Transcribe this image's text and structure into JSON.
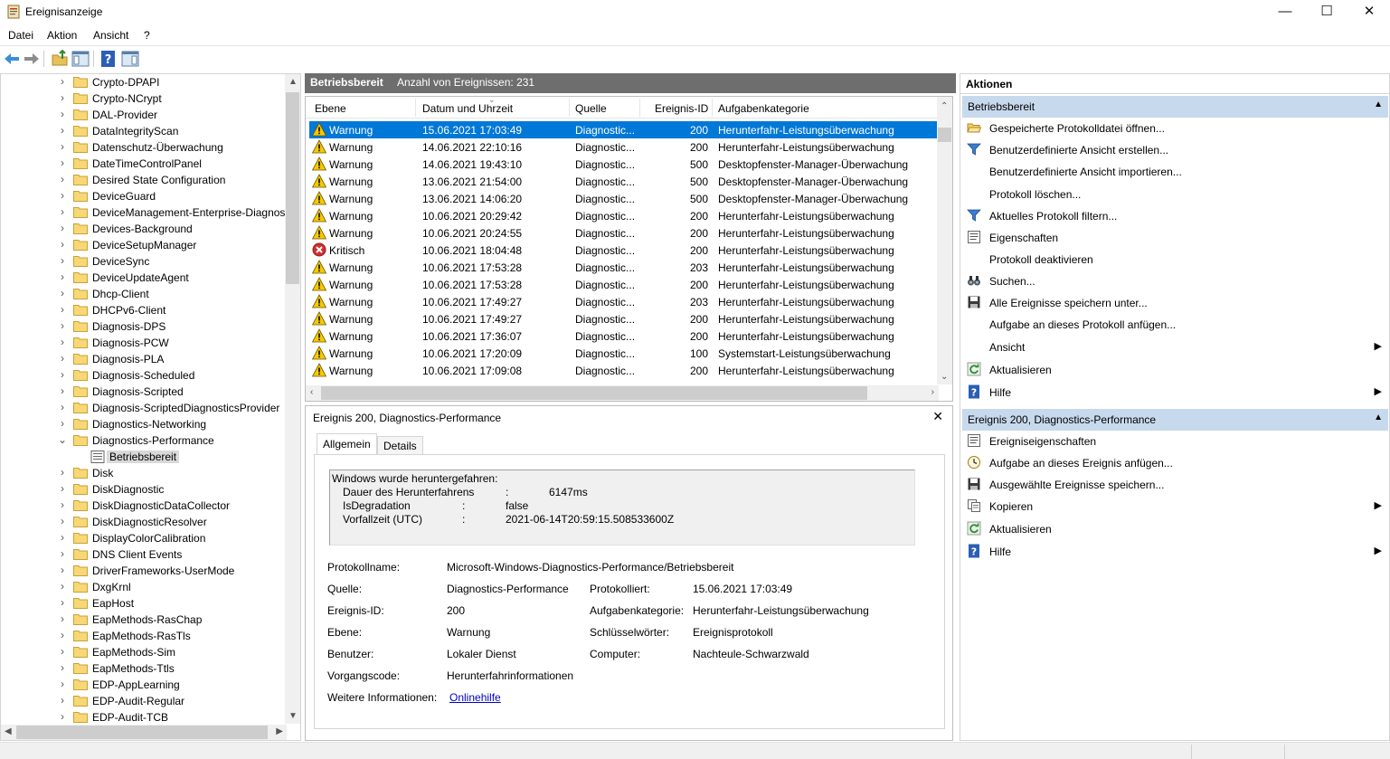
{
  "window": {
    "title": "Ereignisanzeige",
    "minimize": "—",
    "maximize": "☐",
    "close": "✕"
  },
  "menu": [
    "Datei",
    "Aktion",
    "Ansicht",
    "?"
  ],
  "tree": {
    "items": [
      {
        "label": "Crypto-DPAPI"
      },
      {
        "label": "Crypto-NCrypt"
      },
      {
        "label": "DAL-Provider"
      },
      {
        "label": "DataIntegrityScan"
      },
      {
        "label": "Datenschutz-Überwachung"
      },
      {
        "label": "DateTimeControlPanel"
      },
      {
        "label": "Desired State Configuration"
      },
      {
        "label": "DeviceGuard"
      },
      {
        "label": "DeviceManagement-Enterprise-Diagnost"
      },
      {
        "label": "Devices-Background"
      },
      {
        "label": "DeviceSetupManager"
      },
      {
        "label": "DeviceSync"
      },
      {
        "label": "DeviceUpdateAgent"
      },
      {
        "label": "Dhcp-Client"
      },
      {
        "label": "DHCPv6-Client"
      },
      {
        "label": "Diagnosis-DPS"
      },
      {
        "label": "Diagnosis-PCW"
      },
      {
        "label": "Diagnosis-PLA"
      },
      {
        "label": "Diagnosis-Scheduled"
      },
      {
        "label": "Diagnosis-Scripted"
      },
      {
        "label": "Diagnosis-ScriptedDiagnosticsProvider"
      },
      {
        "label": "Diagnostics-Networking"
      },
      {
        "label": "Diagnostics-Performance",
        "expanded": true
      },
      {
        "label": "Betriebsbereit",
        "child": true,
        "selected": true
      },
      {
        "label": "Disk"
      },
      {
        "label": "DiskDiagnostic"
      },
      {
        "label": "DiskDiagnosticDataCollector"
      },
      {
        "label": "DiskDiagnosticResolver"
      },
      {
        "label": "DisplayColorCalibration"
      },
      {
        "label": "DNS Client Events"
      },
      {
        "label": "DriverFrameworks-UserMode"
      },
      {
        "label": "DxgKrnl"
      },
      {
        "label": "EapHost"
      },
      {
        "label": "EapMethods-RasChap"
      },
      {
        "label": "EapMethods-RasTls"
      },
      {
        "label": "EapMethods-Sim"
      },
      {
        "label": "EapMethods-Ttls"
      },
      {
        "label": "EDP-AppLearning"
      },
      {
        "label": "EDP-Audit-Regular"
      },
      {
        "label": "EDP-Audit-TCB"
      }
    ]
  },
  "center": {
    "header_title": "Betriebsbereit",
    "header_count": "Anzahl von Ereignissen: 231",
    "columns": [
      "Ebene",
      "Datum und Uhrzeit",
      "Quelle",
      "Ereignis-ID",
      "Aufgabenkategorie"
    ],
    "rows": [
      {
        "level": "Warnung",
        "date": "15.06.2021 17:03:49",
        "source": "Diagnostic...",
        "id": "200",
        "category": "Herunterfahr-Leistungsüberwachung",
        "type": "warning"
      },
      {
        "level": "Warnung",
        "date": "14.06.2021 22:10:16",
        "source": "Diagnostic...",
        "id": "200",
        "category": "Herunterfahr-Leistungsüberwachung",
        "type": "warning"
      },
      {
        "level": "Warnung",
        "date": "14.06.2021 19:43:10",
        "source": "Diagnostic...",
        "id": "500",
        "category": "Desktopfenster-Manager-Überwachung",
        "type": "warning"
      },
      {
        "level": "Warnung",
        "date": "13.06.2021 21:54:00",
        "source": "Diagnostic...",
        "id": "500",
        "category": "Desktopfenster-Manager-Überwachung",
        "type": "warning"
      },
      {
        "level": "Warnung",
        "date": "13.06.2021 14:06:20",
        "source": "Diagnostic...",
        "id": "500",
        "category": "Desktopfenster-Manager-Überwachung",
        "type": "warning"
      },
      {
        "level": "Warnung",
        "date": "10.06.2021 20:29:42",
        "source": "Diagnostic...",
        "id": "200",
        "category": "Herunterfahr-Leistungsüberwachung",
        "type": "warning"
      },
      {
        "level": "Warnung",
        "date": "10.06.2021 20:24:55",
        "source": "Diagnostic...",
        "id": "200",
        "category": "Herunterfahr-Leistungsüberwachung",
        "type": "warning"
      },
      {
        "level": "Kritisch",
        "date": "10.06.2021 18:04:48",
        "source": "Diagnostic...",
        "id": "200",
        "category": "Herunterfahr-Leistungsüberwachung",
        "type": "critical"
      },
      {
        "level": "Warnung",
        "date": "10.06.2021 17:53:28",
        "source": "Diagnostic...",
        "id": "203",
        "category": "Herunterfahr-Leistungsüberwachung",
        "type": "warning"
      },
      {
        "level": "Warnung",
        "date": "10.06.2021 17:53:28",
        "source": "Diagnostic...",
        "id": "200",
        "category": "Herunterfahr-Leistungsüberwachung",
        "type": "warning"
      },
      {
        "level": "Warnung",
        "date": "10.06.2021 17:49:27",
        "source": "Diagnostic...",
        "id": "203",
        "category": "Herunterfahr-Leistungsüberwachung",
        "type": "warning"
      },
      {
        "level": "Warnung",
        "date": "10.06.2021 17:49:27",
        "source": "Diagnostic...",
        "id": "200",
        "category": "Herunterfahr-Leistungsüberwachung",
        "type": "warning"
      },
      {
        "level": "Warnung",
        "date": "10.06.2021 17:36:07",
        "source": "Diagnostic...",
        "id": "200",
        "category": "Herunterfahr-Leistungsüberwachung",
        "type": "warning"
      },
      {
        "level": "Warnung",
        "date": "10.06.2021 17:20:09",
        "source": "Diagnostic...",
        "id": "100",
        "category": "Systemstart-Leistungsüberwachung",
        "type": "warning"
      },
      {
        "level": "Warnung",
        "date": "10.06.2021 17:09:08",
        "source": "Diagnostic...",
        "id": "200",
        "category": "Herunterfahr-Leistungsüberwachung",
        "type": "warning"
      }
    ]
  },
  "detail": {
    "title": "Ereignis 200, Diagnostics-Performance",
    "tabs": [
      "Allgemein",
      "Details"
    ],
    "message": {
      "heading": "Windows wurde heruntergefahren:",
      "lines": [
        {
          "key": "Dauer des Herunterfahrens",
          "sep": ":",
          "value": "6147ms"
        },
        {
          "key": "IsDegradation",
          "sep": ":",
          "value": "false"
        },
        {
          "key": "Vorfallzeit (UTC)",
          "sep": ":",
          "value": "2021-06-14T20:59:15.508533600Z"
        }
      ]
    },
    "props": {
      "protokollname_label": "Protokollname:",
      "protokollname": "Microsoft-Windows-Diagnostics-Performance/Betriebsbereit",
      "quelle_label": "Quelle:",
      "quelle": "Diagnostics-Performance",
      "protokolliert_label": "Protokolliert:",
      "protokolliert": "15.06.2021 17:03:49",
      "id_label": "Ereignis-ID:",
      "id": "200",
      "kategorie_label": "Aufgabenkategorie:",
      "kategorie": "Herunterfahr-Leistungsüberwachung",
      "ebene_label": "Ebene:",
      "ebene": "Warnung",
      "schluessel_label": "Schlüsselwörter:",
      "schluessel": "Ereignisprotokoll",
      "benutzer_label": "Benutzer:",
      "benutzer": "Lokaler Dienst",
      "computer_label": "Computer:",
      "computer": "Nachteule-Schwarzwald",
      "vorgang_label": "Vorgangscode:",
      "vorgang": "Herunterfahrinformationen",
      "weitere_label": "Weitere Informationen:",
      "weitere": "Onlinehilfe"
    }
  },
  "actions": {
    "title": "Aktionen",
    "section1": "Betriebsbereit",
    "items1": [
      {
        "label": "Gespeicherte Protokolldatei öffnen...",
        "icon": "open-folder-icon"
      },
      {
        "label": "Benutzerdefinierte Ansicht erstellen...",
        "icon": "filter-icon"
      },
      {
        "label": "Benutzerdefinierte Ansicht importieren...",
        "icon": ""
      },
      {
        "label": "Protokoll löschen...",
        "icon": ""
      },
      {
        "label": "Aktuelles Protokoll filtern...",
        "icon": "filter-icon"
      },
      {
        "label": "Eigenschaften",
        "icon": "properties-icon"
      },
      {
        "label": "Protokoll deaktivieren",
        "icon": ""
      },
      {
        "label": "Suchen...",
        "icon": "binoculars-icon"
      },
      {
        "label": "Alle Ereignisse speichern unter...",
        "icon": "save-icon"
      },
      {
        "label": "Aufgabe an dieses Protokoll anfügen...",
        "icon": ""
      },
      {
        "label": "Ansicht",
        "icon": "",
        "submenu": true
      },
      {
        "label": "Aktualisieren",
        "icon": "refresh-icon"
      },
      {
        "label": "Hilfe",
        "icon": "help-icon",
        "submenu": true
      }
    ],
    "section2": "Ereignis 200, Diagnostics-Performance",
    "items2": [
      {
        "label": "Ereigniseigenschaften",
        "icon": "properties-icon"
      },
      {
        "label": "Aufgabe an dieses Ereignis anfügen...",
        "icon": "task-icon"
      },
      {
        "label": "Ausgewählte Ereignisse speichern...",
        "icon": "save-icon"
      },
      {
        "label": "Kopieren",
        "icon": "copy-icon",
        "submenu": true
      },
      {
        "label": "Aktualisieren",
        "icon": "refresh-icon"
      },
      {
        "label": "Hilfe",
        "icon": "help-icon",
        "submenu": true
      }
    ]
  }
}
